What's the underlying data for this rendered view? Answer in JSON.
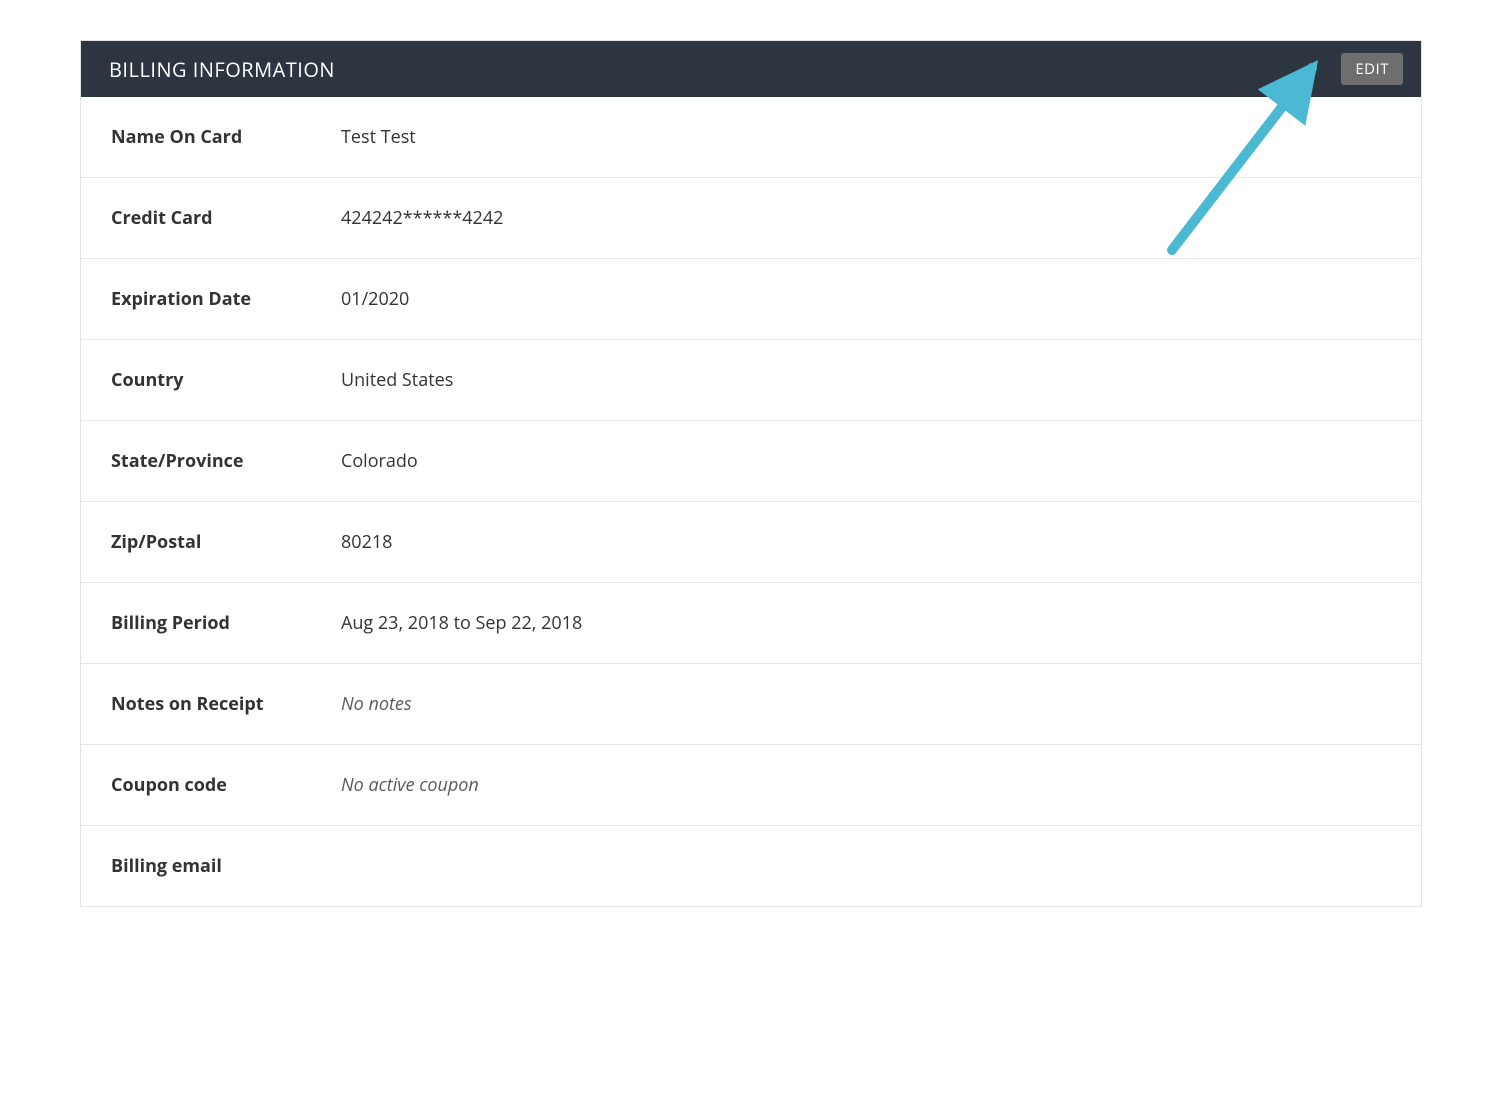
{
  "header": {
    "title": "BILLING INFORMATION",
    "edit_label": "EDIT"
  },
  "rows": [
    {
      "label": "Name On Card",
      "value": "Test Test",
      "italic": false
    },
    {
      "label": "Credit Card",
      "value": "424242******4242",
      "italic": false
    },
    {
      "label": "Expiration Date",
      "value": "01/2020",
      "italic": false
    },
    {
      "label": "Country",
      "value": "United States",
      "italic": false
    },
    {
      "label": "State/Province",
      "value": "Colorado",
      "italic": false
    },
    {
      "label": "Zip/Postal",
      "value": "80218",
      "italic": false
    },
    {
      "label": "Billing Period",
      "value": "Aug 23, 2018 to Sep 22, 2018",
      "italic": false
    },
    {
      "label": "Notes on Receipt",
      "value": "No notes",
      "italic": true
    },
    {
      "label": "Coupon code",
      "value": "No active coupon",
      "italic": true
    },
    {
      "label": "Billing email",
      "value": "",
      "italic": false
    }
  ],
  "annotation": {
    "arrow_color": "#4cb9d4"
  }
}
